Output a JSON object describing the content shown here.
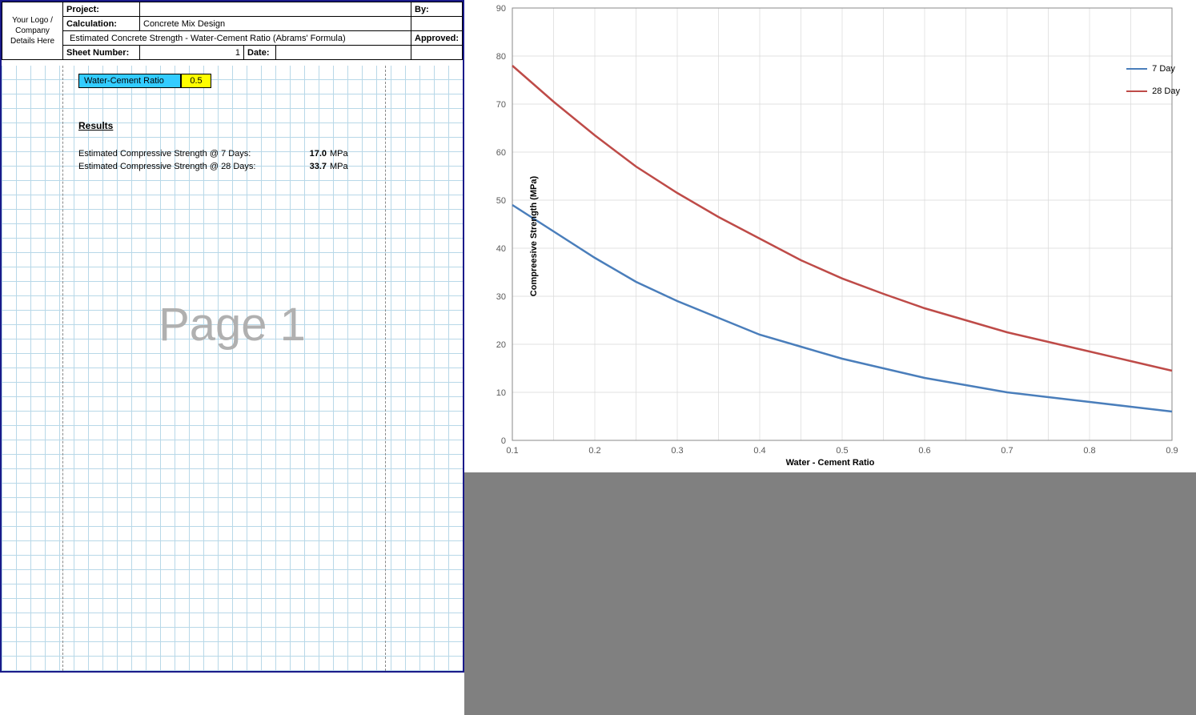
{
  "header": {
    "logo_placeholder": "Your Logo / Company Details Here",
    "project_label": "Project:",
    "project_value": "",
    "calculation_label": "Calculation:",
    "calculation_value": "Concrete Mix Design",
    "subtitle": "Estimated Concrete Strength - Water-Cement Ratio (Abrams' Formula)",
    "sheet_label": "Sheet Number:",
    "sheet_value": "1",
    "date_label": "Date:",
    "date_value": "",
    "by_label": "By:",
    "by_value": "",
    "approved_label": "Approved:",
    "approved_value": ""
  },
  "input": {
    "label": "Water-Cement Ratio",
    "value": "0.5"
  },
  "results": {
    "heading": "Results",
    "row7_label": "Estimated Compressive Strength @ 7 Days:",
    "row7_value": "17.0",
    "row7_unit": "MPa",
    "row28_label": "Estimated Compressive Strength @ 28 Days:",
    "row28_value": "33.7",
    "row28_unit": "MPa"
  },
  "watermark": "Page 1",
  "chart_data": {
    "type": "line",
    "title": "",
    "xlabel": "Water - Cement Ratio",
    "ylabel": "Compreesive Strength (MPa)",
    "xlim": [
      0.1,
      0.9
    ],
    "ylim": [
      0,
      90
    ],
    "x_ticks": [
      0.1,
      0.2,
      0.3,
      0.4,
      0.5,
      0.6,
      0.7,
      0.8,
      0.9
    ],
    "y_ticks": [
      0,
      10,
      20,
      30,
      40,
      50,
      60,
      70,
      80,
      90
    ],
    "x": [
      0.1,
      0.15,
      0.2,
      0.25,
      0.3,
      0.35,
      0.4,
      0.45,
      0.5,
      0.55,
      0.6,
      0.65,
      0.7,
      0.75,
      0.8,
      0.85,
      0.9
    ],
    "series": [
      {
        "name": "7 Day",
        "color": "#4a7ebb",
        "values": [
          49.0,
          43.5,
          38.0,
          33.0,
          29.0,
          25.5,
          22.0,
          19.5,
          17.0,
          15.0,
          13.0,
          11.5,
          10.0,
          9.0,
          8.0,
          7.0,
          6.0
        ]
      },
      {
        "name": "28 Day",
        "color": "#be4b48",
        "values": [
          78.0,
          70.5,
          63.5,
          57.0,
          51.5,
          46.5,
          42.0,
          37.5,
          33.7,
          30.5,
          27.5,
          25.0,
          22.5,
          20.5,
          18.5,
          16.5,
          14.5
        ]
      }
    ],
    "legend_position": "top-right",
    "grid": true
  }
}
